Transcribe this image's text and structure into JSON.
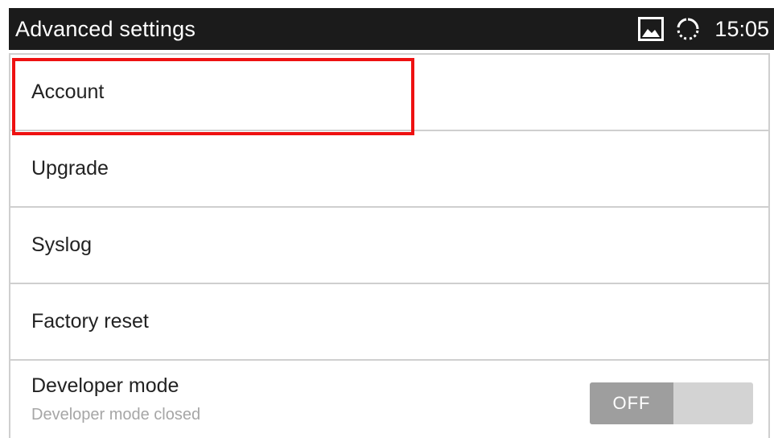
{
  "status_bar": {
    "title": "Advanced settings",
    "time": "15:05",
    "icons": [
      "image-icon",
      "sync-icon"
    ]
  },
  "menu": {
    "items": [
      {
        "label": "Account"
      },
      {
        "label": "Upgrade"
      },
      {
        "label": "Syslog"
      },
      {
        "label": "Factory reset"
      },
      {
        "label": "Developer mode",
        "subtitle": "Developer mode closed"
      }
    ],
    "developer_toggle": {
      "state_label": "OFF",
      "on": false
    },
    "highlighted_item": "Account"
  },
  "colors": {
    "status_bar_bg": "#1b1b1b",
    "highlight": "#ee1111",
    "toggle_track": "#d3d3d3",
    "toggle_knob": "#9e9e9e",
    "subtitle": "#a6a6a6"
  }
}
